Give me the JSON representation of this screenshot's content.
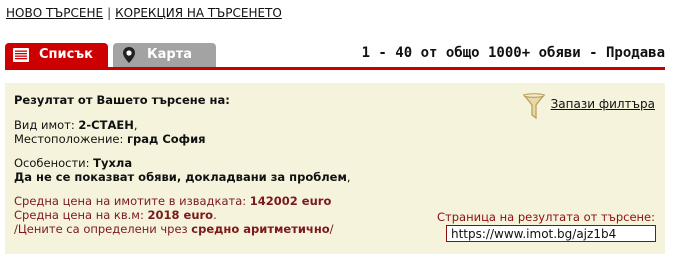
{
  "topnav": {
    "new_search": "НОВО ТЪРСЕНЕ",
    "separator": "|",
    "edit_search": "КОРЕКЦИЯ НА ТЪРСЕНЕТО"
  },
  "tabs": [
    {
      "label": "Списък",
      "icon": "list-icon",
      "active": true
    },
    {
      "label": "Карта",
      "icon": "map-pin-icon",
      "active": false
    }
  ],
  "results_count": "1 - 40 от общо 1000+ обяви - Продава",
  "summary": {
    "heading": "Резултат от Вашето търсене на:",
    "type_label": "Вид имот:",
    "type_value": "2-СТАЕН",
    "location_label": "Местоположение:",
    "location_value": "град София",
    "features_label": "Особености:",
    "features_value": "Тухла",
    "exclusion": "Да не се показват обяви, докладвани за проблем",
    "avg_price_label": "Средна цена на имотите в извадката:",
    "avg_price_value": "142002 euro",
    "avg_sqm_label": "Средна цена на кв.м:",
    "avg_sqm_value": "2018 euro",
    "note_prefix": "/Цените са определени чрез",
    "note_method": "средно аритметично",
    "note_suffix": "/"
  },
  "save_filter": "Запази филтъра",
  "result_page": {
    "label": "Страница на резултата от търсене:",
    "url": "https://www.imot.bg/ajz1b4"
  },
  "colors": {
    "accent_red": "#cc0000",
    "panel_bg": "#f6f3dc",
    "inactive_tab": "#a3a3a3",
    "dark_red_text": "#7a1a1a"
  }
}
